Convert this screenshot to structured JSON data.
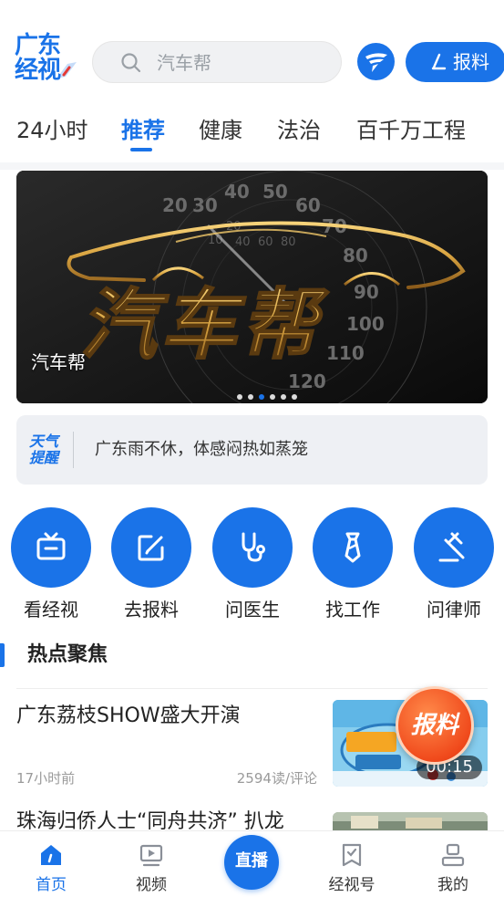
{
  "header": {
    "logo_line1": "广东",
    "logo_line2": "经视",
    "search_placeholder": "汽车帮",
    "report_label": "报料"
  },
  "tabs": [
    {
      "label": "24小时",
      "active": false
    },
    {
      "label": "推荐",
      "active": true
    },
    {
      "label": "健康",
      "active": false
    },
    {
      "label": "法治",
      "active": false
    },
    {
      "label": "百千万工程",
      "active": false
    }
  ],
  "banner": {
    "caption": "汽车帮",
    "title_art": "汽车帮",
    "speedo_ticks": [
      "20",
      "30",
      "40",
      "50",
      "60",
      "70",
      "80",
      "90",
      "100",
      "110",
      "120",
      "10",
      "20",
      "40",
      "60",
      "80"
    ],
    "slide_count": 6,
    "active_slide": 3
  },
  "weather": {
    "badge_line1": "天气",
    "badge_line2": "提醒",
    "text": "广东雨不休，体感闷热如蒸笼"
  },
  "services": [
    {
      "label": "看经视",
      "icon": "tv-icon"
    },
    {
      "label": "去报料",
      "icon": "edit-icon"
    },
    {
      "label": "问医生",
      "icon": "stethoscope-icon"
    },
    {
      "label": "找工作",
      "icon": "tie-icon"
    },
    {
      "label": "问律师",
      "icon": "gavel-icon"
    }
  ],
  "section": {
    "title": "热点聚焦"
  },
  "news": [
    {
      "title": "广东荔枝SHOW盛大开演",
      "time": "17小时前",
      "stats": "2594读/评论",
      "duration": "00:15"
    },
    {
      "title": "珠海归侨人士“同舟共济” 扒龙"
    }
  ],
  "float_button": {
    "label": "报料"
  },
  "bottom_nav": {
    "items": [
      {
        "label": "首页",
        "icon": "home-icon",
        "active": true
      },
      {
        "label": "视频",
        "icon": "video-icon",
        "active": false
      },
      {
        "label": "经视号",
        "icon": "bookmark-icon",
        "active": false
      },
      {
        "label": "我的",
        "icon": "profile-icon",
        "active": false
      }
    ],
    "live_label": "直播"
  },
  "colors": {
    "accent": "#1a73e8",
    "float_orange": "#f04a1c",
    "banner_gold": "#d9a441"
  }
}
